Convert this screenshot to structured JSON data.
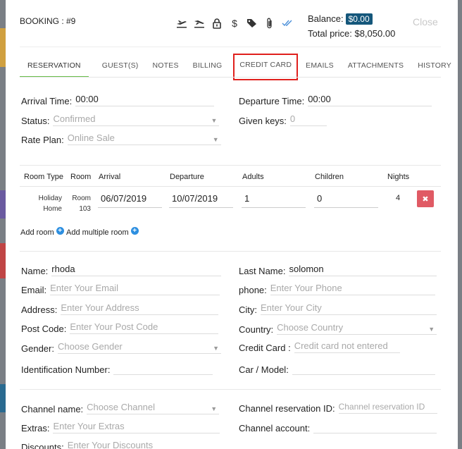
{
  "header": {
    "booking_label": "BOOKING : #9",
    "balance_label": "Balance:",
    "balance_value": "$0.00",
    "total_price": "Total price: $8,050.00",
    "close_label": "Close",
    "icons": [
      "check-in-icon",
      "check-out-icon",
      "lock-icon",
      "dollar-icon",
      "tags-icon",
      "paperclip-icon",
      "double-check-icon"
    ]
  },
  "tabs": [
    {
      "label": "RESERVATION",
      "active": true
    },
    {
      "label": "GUEST(S)"
    },
    {
      "label": "NOTES"
    },
    {
      "label": "BILLING"
    },
    {
      "label": "CREDIT CARD",
      "highlighted": true
    },
    {
      "label": "EMAILS"
    },
    {
      "label": "ATTACHMENTS"
    },
    {
      "label": "HISTORY"
    }
  ],
  "reservation": {
    "arrival_label": "Arrival Time:",
    "arrival_value": "00:00",
    "departure_label": "Departure Time:",
    "departure_value": "00:00",
    "status_label": "Status:",
    "status_value": "Confirmed",
    "given_keys_label": "Given keys:",
    "given_keys_value": "0",
    "rate_plan_label": "Rate Plan:",
    "rate_plan_value": "Online Sale"
  },
  "rooms_table": {
    "headers": [
      "Room Type",
      "Room",
      "Arrival",
      "Departure",
      "Adults",
      "Children",
      "Nights"
    ],
    "rows": [
      {
        "room_type_1": "Holiday",
        "room_type_2": "Home",
        "room_1": "Room",
        "room_2": "103",
        "arrival": "06/07/2019",
        "departure": "10/07/2019",
        "adults": "1",
        "children": "0",
        "nights": "4",
        "delete_icon": "✖"
      }
    ],
    "add_room": "Add room",
    "add_multiple_room": "Add multiple room"
  },
  "guest": {
    "name_label": "Name:",
    "name_value": "rhoda",
    "last_name_label": "Last Name:",
    "last_name_value": "solomon",
    "email_label": "Email:",
    "email_placeholder": "Enter Your Email",
    "phone_label": "phone:",
    "phone_placeholder": "Enter Your Phone",
    "address_label": "Address:",
    "address_placeholder": "Enter Your Address",
    "city_label": "City:",
    "city_placeholder": "Enter Your City",
    "post_code_label": "Post Code:",
    "post_code_placeholder": "Enter Your Post Code",
    "country_label": "Country:",
    "country_placeholder": "Choose Country",
    "gender_label": "Gender:",
    "gender_placeholder": "Choose Gender",
    "credit_card_label": "Credit Card :",
    "credit_card_value": "Credit card not entered",
    "id_number_label": "Identification Number:",
    "car_label": "Car / Model:"
  },
  "channel": {
    "channel_name_label": "Channel name:",
    "channel_name_placeholder": "Choose Channel",
    "channel_res_id_label": "Channel reservation ID:",
    "channel_res_id_placeholder": "Channel reservation ID",
    "extras_label": "Extras:",
    "extras_placeholder": "Enter Your Extras",
    "channel_account_label": "Channel account:",
    "discounts_label": "Discounts:",
    "discounts_placeholder": "Enter Your Discounts"
  },
  "colors": {
    "accent_tab": "#6abf4b",
    "balance_badge": "#15577b",
    "highlight": "#e0201d",
    "delete_button": "#e05a64",
    "add_icon": "#2d8fe0"
  }
}
